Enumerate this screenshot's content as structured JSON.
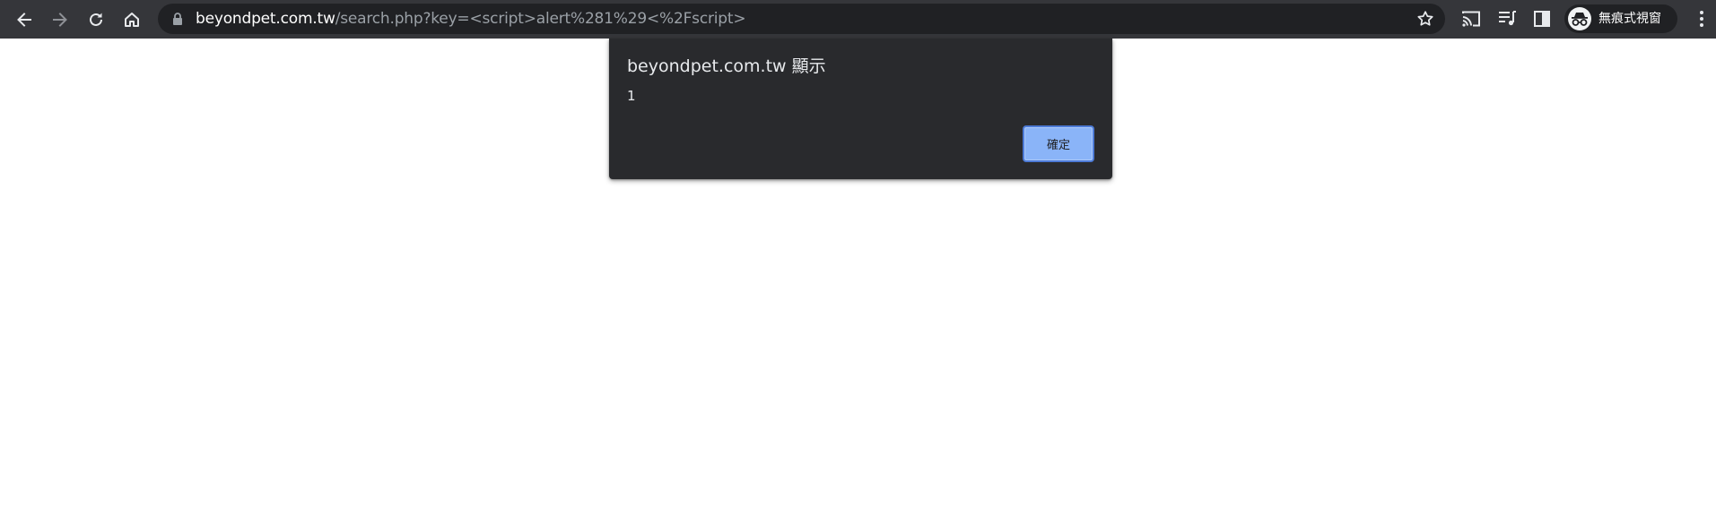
{
  "browser": {
    "url_host": "beyondpet.com.tw",
    "url_rest": "/search.php?key=<script>alert%281%29<%2Fscript>",
    "incognito_label": "無痕式視窗",
    "icons": {
      "back": "arrow-left-icon",
      "forward": "arrow-right-icon",
      "reload": "reload-icon",
      "home": "home-icon",
      "lock": "lock-icon",
      "bookmark": "star-icon",
      "cast": "cast-icon",
      "media": "playlist-icon",
      "side_panel": "side-panel-icon",
      "incognito": "incognito-icon",
      "menu": "three-dot-menu-icon"
    },
    "colors": {
      "toolbar": "#35363a",
      "omnibox": "#202124",
      "dialog": "#292a2d",
      "button": "#8ab4f8"
    }
  },
  "dialog": {
    "title": "beyondpet.com.tw 顯示",
    "message": "1",
    "ok_label": "確定"
  }
}
